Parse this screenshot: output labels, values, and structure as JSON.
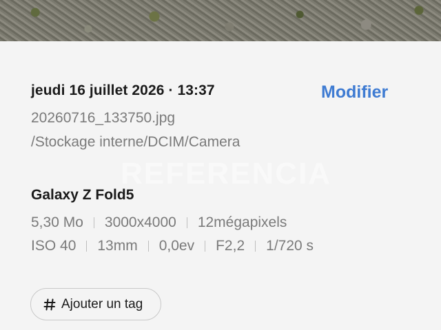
{
  "photo": {
    "description_icon": "photo-preview"
  },
  "details": {
    "date": "jeudi 16 juillet 2026 · 13:37",
    "edit_label": "Modifier",
    "filename": "20260716_133750.jpg",
    "path": "/Stockage interne/DCIM/Camera"
  },
  "camera": {
    "device": "Galaxy Z Fold5",
    "specs_row1": [
      "5,30 Mo",
      "3000x4000",
      "12mégapixels"
    ],
    "specs_row2": [
      "ISO 40",
      "13mm",
      "0,0ev",
      "F2,2",
      "1/720 s"
    ]
  },
  "tag_button": {
    "label": "Ajouter un tag",
    "icon": "hash-icon"
  },
  "watermark": {
    "text": "REFERENCIA"
  },
  "colors": {
    "accent": "#3e7bd2",
    "background": "#f4f4f4",
    "secondary_text": "#7a7a7a"
  }
}
